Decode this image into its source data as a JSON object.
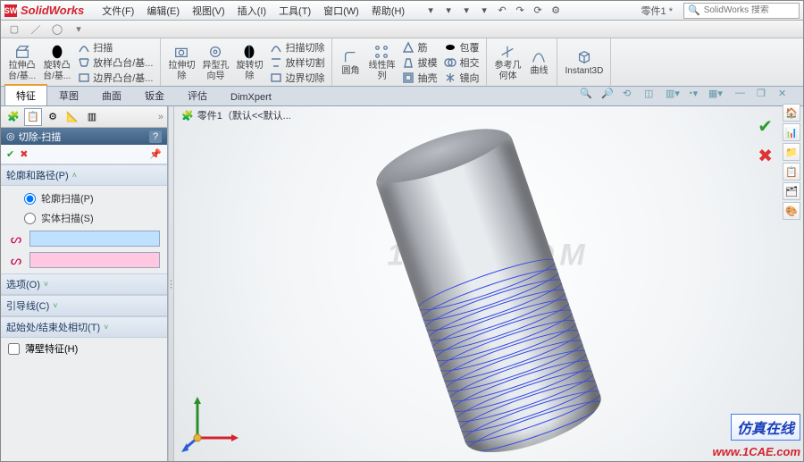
{
  "app": {
    "brand": "SolidWorks",
    "doc_name": "零件1 *",
    "search_placeholder": "SolidWorks 搜索"
  },
  "menu": [
    {
      "label": "文件(F)"
    },
    {
      "label": "编辑(E)"
    },
    {
      "label": "视图(V)"
    },
    {
      "label": "插入(I)"
    },
    {
      "label": "工具(T)"
    },
    {
      "label": "窗口(W)"
    },
    {
      "label": "帮助(H)"
    }
  ],
  "qat": [
    "new-icon",
    "open-icon",
    "save-icon",
    "print-icon",
    "undo-icon",
    "redo-icon",
    "rebuild-icon",
    "options-icon"
  ],
  "ribbon": {
    "groups": [
      {
        "big": [
          {
            "icon": "extrude-icon",
            "l1": "拉伸凸",
            "l2": "台/基..."
          },
          {
            "icon": "revolve-icon",
            "l1": "旋转凸",
            "l2": "台/基..."
          }
        ],
        "mini": [
          {
            "icon": "sweep-icon",
            "label": "扫描"
          },
          {
            "icon": "loft-icon",
            "label": "放样凸台/基..."
          },
          {
            "icon": "boundary-icon",
            "label": "边界凸台/基..."
          }
        ]
      },
      {
        "big": [
          {
            "icon": "cut-extrude-icon",
            "l1": "拉伸切",
            "l2": "除"
          },
          {
            "icon": "hole-icon",
            "l1": "异型孔",
            "l2": "向导"
          },
          {
            "icon": "cut-revolve-icon",
            "l1": "旋转切",
            "l2": "除"
          }
        ],
        "mini": [
          {
            "icon": "sweep-cut-icon",
            "label": "扫描切除"
          },
          {
            "icon": "loft-cut-icon",
            "label": "放样切割"
          },
          {
            "icon": "boundary-cut-icon",
            "label": "边界切除"
          }
        ]
      },
      {
        "big": [
          {
            "icon": "fillet-icon",
            "l1": "圆角",
            "l2": ""
          },
          {
            "icon": "pattern-icon",
            "l1": "线性阵",
            "l2": "列"
          }
        ],
        "mini": [
          {
            "icon": "rib-icon",
            "label": "筋"
          },
          {
            "icon": "draft-icon",
            "label": "拔模"
          },
          {
            "icon": "shell-icon",
            "label": "抽壳"
          }
        ]
      },
      {
        "big": [],
        "mini": [
          {
            "icon": "wrap-icon",
            "label": "包覆"
          },
          {
            "icon": "intersect-icon",
            "label": "相交"
          },
          {
            "icon": "mirror-icon",
            "label": "镜向"
          }
        ]
      },
      {
        "big": [
          {
            "icon": "refgeom-icon",
            "l1": "参考几",
            "l2": "何体"
          },
          {
            "icon": "curves-icon",
            "l1": "曲线",
            "l2": ""
          }
        ],
        "mini": []
      },
      {
        "big": [
          {
            "icon": "instant3d-icon",
            "l1": "Instant3D",
            "l2": ""
          }
        ],
        "mini": []
      }
    ]
  },
  "tabs": [
    {
      "label": "特征",
      "active": true
    },
    {
      "label": "草图"
    },
    {
      "label": "曲面"
    },
    {
      "label": "钣金"
    },
    {
      "label": "评估"
    },
    {
      "label": "DimXpert"
    }
  ],
  "breadcrumb": "零件1（默认<<默认...",
  "pm": {
    "title": "切除-扫描",
    "sec_profile": "轮廓和路径(P)",
    "radio_sketch": "轮廓扫描(P)",
    "radio_solid": "实体扫描(S)",
    "sec_options": "选项(O)",
    "sec_guide": "引导线(C)",
    "sec_startend": "起始处/结束处相切(T)",
    "chk_thin": "薄壁特征(H)"
  },
  "right_dock": [
    "home-icon",
    "chart-icon",
    "folder-icon",
    "clipboard-icon",
    "sheet-icon",
    "warn-icon"
  ],
  "badge": {
    "text": "仿真在线",
    "url": "www.1CAE.com"
  },
  "watermark": "1CAE.COM"
}
